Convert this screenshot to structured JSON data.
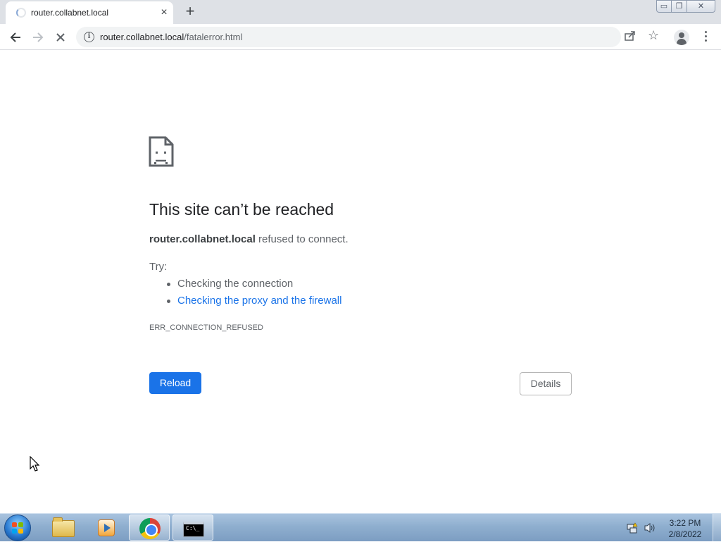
{
  "browser": {
    "tab_title": "router.collabnet.local",
    "tab_close": "×",
    "new_tab": "+",
    "window_buttons": {
      "minimize": "▭",
      "maximize": "❐",
      "close": "✕"
    },
    "url_host": "router.collabnet.local",
    "url_path": "/fatalerror.html",
    "icons": [
      "back-arrow-icon",
      "forward-arrow-icon",
      "stop-loading-icon",
      "info-icon",
      "share-icon",
      "star-icon",
      "profile-icon",
      "menu-icon"
    ]
  },
  "error_page": {
    "title": "This site can’t be reached",
    "host": "router.collabnet.local",
    "message": "refused to connect.",
    "try_label": "Try:",
    "suggestions": [
      "Checking the connection",
      "Checking the proxy and the firewall"
    ],
    "error_code": "ERR_CONNECTION_REFUSED",
    "reload_label": "Reload",
    "details_label": "Details"
  },
  "taskbar": {
    "time": "3:22 PM",
    "date": "2/8/2022",
    "cmd_prompt_text": "C:\\_",
    "apps": [
      "windows-explorer",
      "windows-media-player",
      "google-chrome",
      "command-prompt"
    ]
  },
  "colors": {
    "link_blue": "#1a73e8",
    "tab_strip": "#dee1e6",
    "omnibox": "#f1f3f4",
    "text_primary": "#202124",
    "text_secondary": "#5f6368"
  }
}
